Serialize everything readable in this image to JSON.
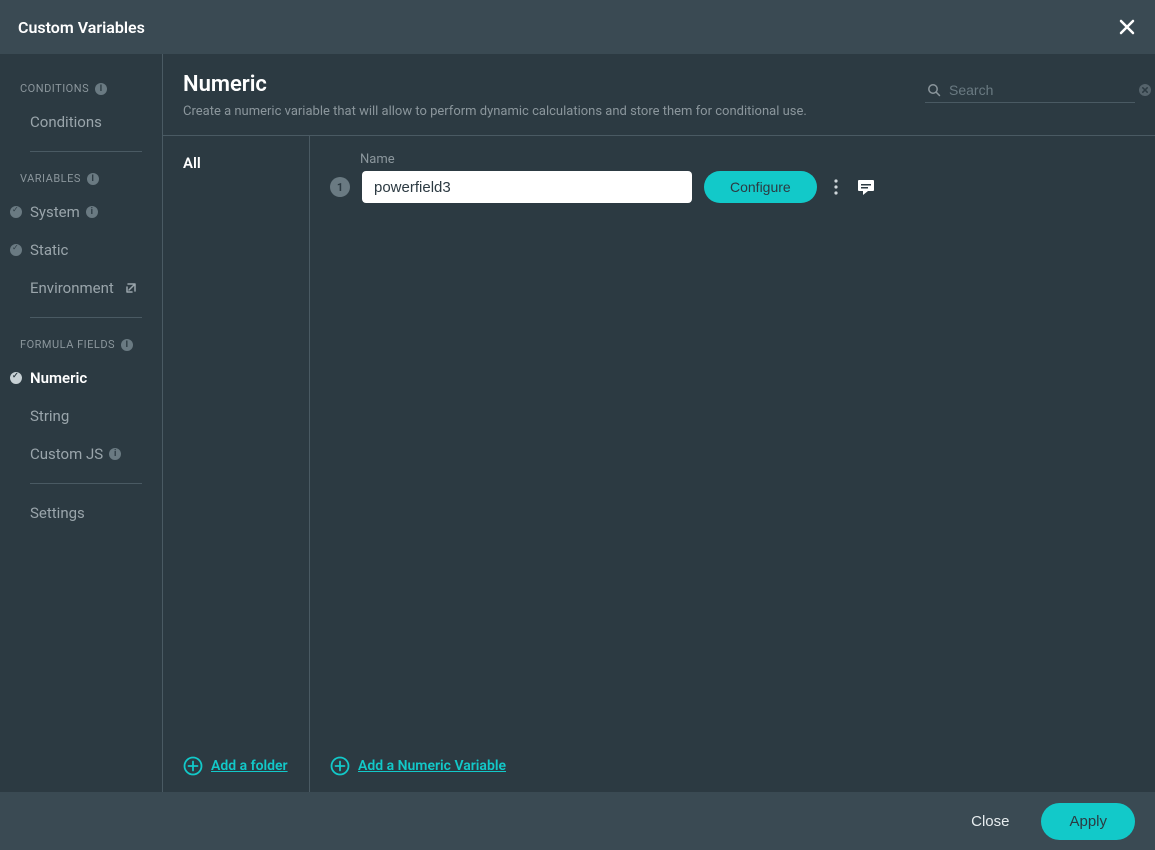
{
  "titlebar": {
    "title": "Custom Variables"
  },
  "sidebar": {
    "sections": {
      "conditions": {
        "header": "CONDITIONS",
        "items": {
          "conditions": "Conditions"
        }
      },
      "variables": {
        "header": "VARIABLES",
        "items": {
          "system": "System",
          "static": "Static",
          "environment": "Environment"
        }
      },
      "formula": {
        "header": "FORMULA FIELDS",
        "items": {
          "numeric": "Numeric",
          "string": "String",
          "customjs": "Custom JS"
        }
      }
    },
    "settings": "Settings"
  },
  "main": {
    "title": "Numeric",
    "description": "Create a numeric variable that will allow to perform dynamic calculations and store them for conditional use.",
    "search_placeholder": "Search"
  },
  "folders": {
    "all": "All",
    "add_folder": "Add a folder"
  },
  "items": {
    "name_label": "Name",
    "row_number": "1",
    "rows": [
      {
        "name": "powerfield3"
      }
    ],
    "configure": "Configure",
    "add_variable": "Add a Numeric Variable"
  },
  "footer": {
    "close": "Close",
    "apply": "Apply"
  },
  "colors": {
    "accent": "#12c9c9"
  }
}
